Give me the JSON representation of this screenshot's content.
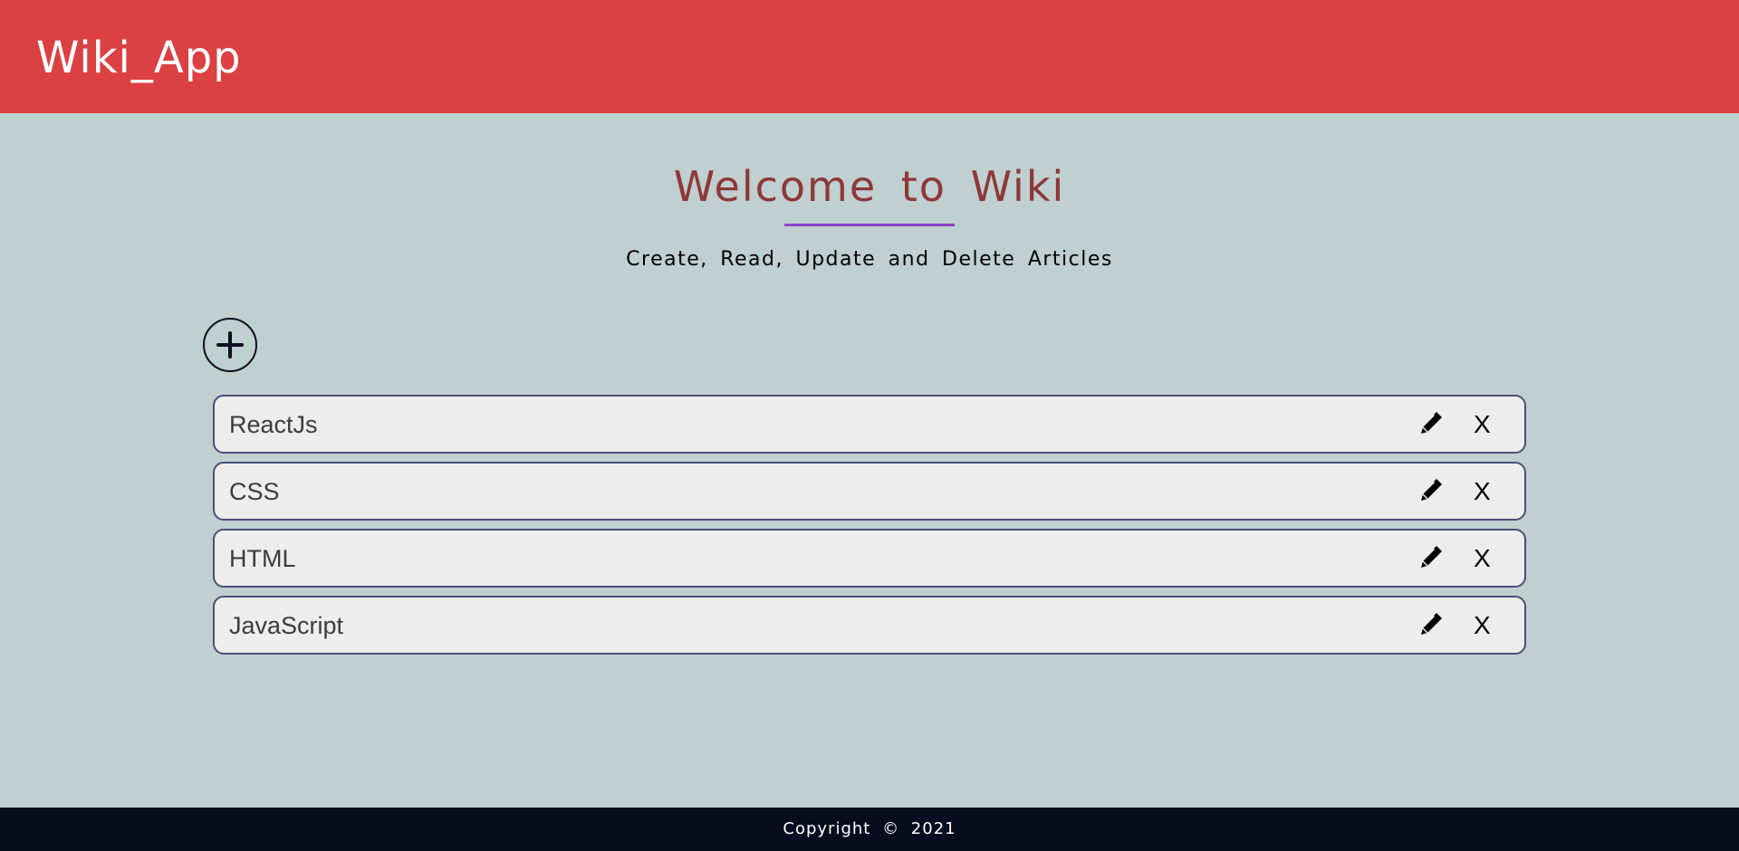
{
  "header": {
    "app_title": "Wiki_App",
    "background_color": "#db4042"
  },
  "main": {
    "heading": "Welcome to Wiki",
    "heading_color": "#8d3838",
    "underline_color": "#8e44c9",
    "subtitle": "Create, Read, Update and Delete Articles",
    "add_icon": "plus-circle-icon",
    "articles": [
      {
        "title": "ReactJs",
        "edit_icon": "pencil-icon",
        "delete_label": "X"
      },
      {
        "title": "CSS",
        "edit_icon": "pencil-icon",
        "delete_label": "X"
      },
      {
        "title": "HTML",
        "edit_icon": "pencil-icon",
        "delete_label": "X"
      },
      {
        "title": "JavaScript",
        "edit_icon": "pencil-icon",
        "delete_label": "X"
      }
    ]
  },
  "footer": {
    "copyright": "Copyright © 2021",
    "background_color": "#070c1e"
  },
  "colors": {
    "page_background": "#c0cfd0",
    "row_background": "#ededed",
    "row_border": "#4a4f78"
  }
}
